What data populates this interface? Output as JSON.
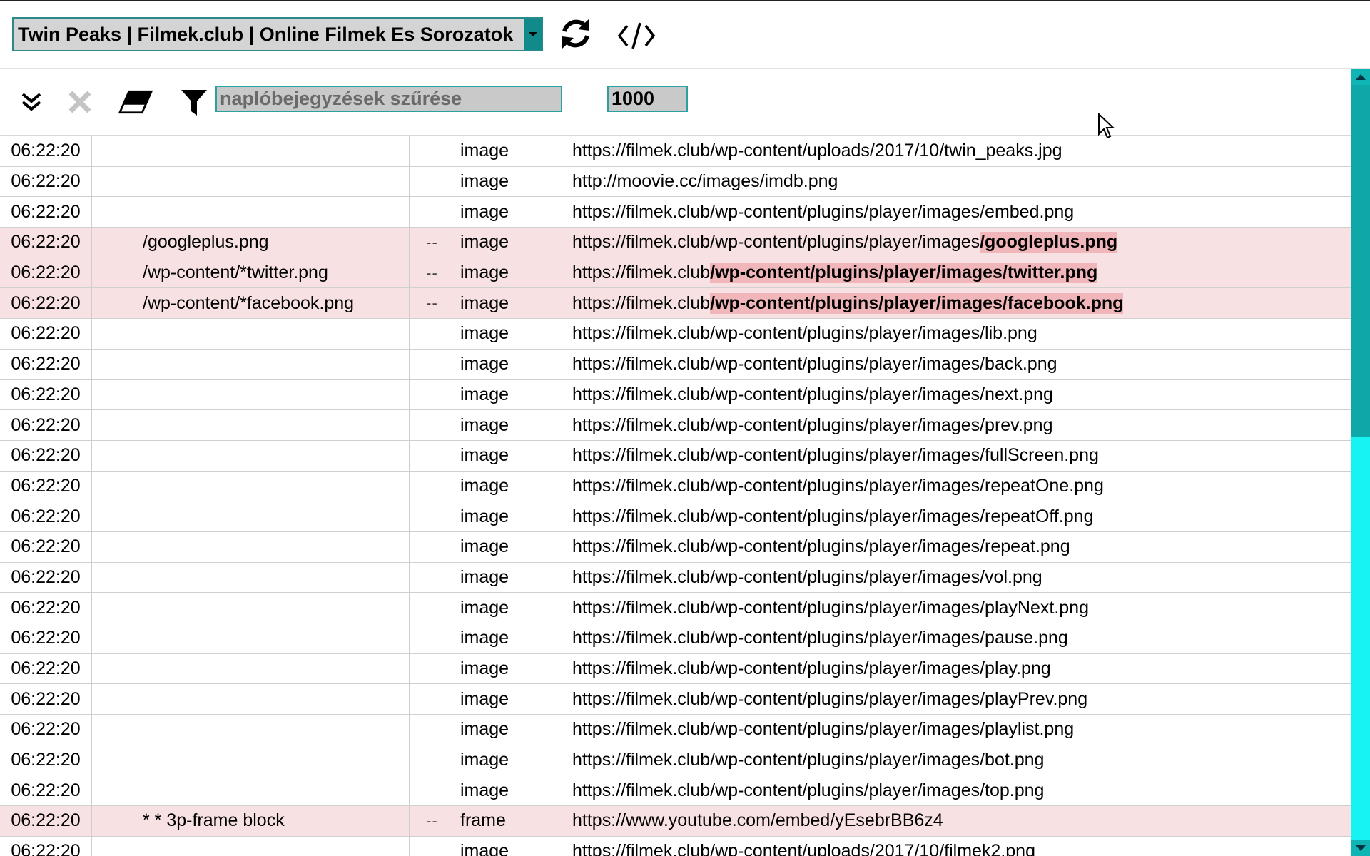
{
  "header": {
    "tab_selector": "Twin Peaks | Filmek.club | Online Filmek Es Sorozatok",
    "reload_icon": "refresh-icon",
    "code_icon": "code-icon"
  },
  "toolbar": {
    "expand_icon": "double-chevron-down-icon",
    "clear_icon": "close-icon",
    "eraser_icon": "eraser-icon",
    "filter_icon": "funnel-icon",
    "filter_placeholder": "naplóbejegyzések szűrése",
    "max_entries": "1000"
  },
  "colors": {
    "accent": "#108a8a",
    "blocked_row": "#f8e1e3",
    "highlight": "#f0b6b9",
    "scrollbar": "#17f2f2"
  },
  "log": {
    "rows": [
      {
        "time": "06:22:20",
        "filter": "",
        "flag": "",
        "type": "image",
        "url_pre": "https://filmek.club/wp-content/uploads/2017/10/twin_peaks.jpg",
        "url_hl": "",
        "blocked": false
      },
      {
        "time": "06:22:20",
        "filter": "",
        "flag": "",
        "type": "image",
        "url_pre": "http://moovie.cc/images/imdb.png",
        "url_hl": "",
        "blocked": false
      },
      {
        "time": "06:22:20",
        "filter": "",
        "flag": "",
        "type": "image",
        "url_pre": "https://filmek.club/wp-content/plugins/player/images/embed.png",
        "url_hl": "",
        "blocked": false
      },
      {
        "time": "06:22:20",
        "filter": "/googleplus.png",
        "flag": "--",
        "type": "image",
        "url_pre": "https://filmek.club/wp-content/plugins/player/images",
        "url_hl": "/googleplus.png",
        "blocked": true
      },
      {
        "time": "06:22:20",
        "filter": "/wp-content/*twitter.png",
        "flag": "--",
        "type": "image",
        "url_pre": "https://filmek.club",
        "url_hl": "/wp-content/plugins/player/images/twitter.png",
        "blocked": true
      },
      {
        "time": "06:22:20",
        "filter": "/wp-content/*facebook.png",
        "flag": "--",
        "type": "image",
        "url_pre": "https://filmek.club",
        "url_hl": "/wp-content/plugins/player/images/facebook.png",
        "blocked": true
      },
      {
        "time": "06:22:20",
        "filter": "",
        "flag": "",
        "type": "image",
        "url_pre": "https://filmek.club/wp-content/plugins/player/images/lib.png",
        "url_hl": "",
        "blocked": false
      },
      {
        "time": "06:22:20",
        "filter": "",
        "flag": "",
        "type": "image",
        "url_pre": "https://filmek.club/wp-content/plugins/player/images/back.png",
        "url_hl": "",
        "blocked": false
      },
      {
        "time": "06:22:20",
        "filter": "",
        "flag": "",
        "type": "image",
        "url_pre": "https://filmek.club/wp-content/plugins/player/images/next.png",
        "url_hl": "",
        "blocked": false
      },
      {
        "time": "06:22:20",
        "filter": "",
        "flag": "",
        "type": "image",
        "url_pre": "https://filmek.club/wp-content/plugins/player/images/prev.png",
        "url_hl": "",
        "blocked": false
      },
      {
        "time": "06:22:20",
        "filter": "",
        "flag": "",
        "type": "image",
        "url_pre": "https://filmek.club/wp-content/plugins/player/images/fullScreen.png",
        "url_hl": "",
        "blocked": false
      },
      {
        "time": "06:22:20",
        "filter": "",
        "flag": "",
        "type": "image",
        "url_pre": "https://filmek.club/wp-content/plugins/player/images/repeatOne.png",
        "url_hl": "",
        "blocked": false
      },
      {
        "time": "06:22:20",
        "filter": "",
        "flag": "",
        "type": "image",
        "url_pre": "https://filmek.club/wp-content/plugins/player/images/repeatOff.png",
        "url_hl": "",
        "blocked": false
      },
      {
        "time": "06:22:20",
        "filter": "",
        "flag": "",
        "type": "image",
        "url_pre": "https://filmek.club/wp-content/plugins/player/images/repeat.png",
        "url_hl": "",
        "blocked": false
      },
      {
        "time": "06:22:20",
        "filter": "",
        "flag": "",
        "type": "image",
        "url_pre": "https://filmek.club/wp-content/plugins/player/images/vol.png",
        "url_hl": "",
        "blocked": false
      },
      {
        "time": "06:22:20",
        "filter": "",
        "flag": "",
        "type": "image",
        "url_pre": "https://filmek.club/wp-content/plugins/player/images/playNext.png",
        "url_hl": "",
        "blocked": false
      },
      {
        "time": "06:22:20",
        "filter": "",
        "flag": "",
        "type": "image",
        "url_pre": "https://filmek.club/wp-content/plugins/player/images/pause.png",
        "url_hl": "",
        "blocked": false
      },
      {
        "time": "06:22:20",
        "filter": "",
        "flag": "",
        "type": "image",
        "url_pre": "https://filmek.club/wp-content/plugins/player/images/play.png",
        "url_hl": "",
        "blocked": false
      },
      {
        "time": "06:22:20",
        "filter": "",
        "flag": "",
        "type": "image",
        "url_pre": "https://filmek.club/wp-content/plugins/player/images/playPrev.png",
        "url_hl": "",
        "blocked": false
      },
      {
        "time": "06:22:20",
        "filter": "",
        "flag": "",
        "type": "image",
        "url_pre": "https://filmek.club/wp-content/plugins/player/images/playlist.png",
        "url_hl": "",
        "blocked": false
      },
      {
        "time": "06:22:20",
        "filter": "",
        "flag": "",
        "type": "image",
        "url_pre": "https://filmek.club/wp-content/plugins/player/images/bot.png",
        "url_hl": "",
        "blocked": false
      },
      {
        "time": "06:22:20",
        "filter": "",
        "flag": "",
        "type": "image",
        "url_pre": "https://filmek.club/wp-content/plugins/player/images/top.png",
        "url_hl": "",
        "blocked": false
      },
      {
        "time": "06:22:20",
        "filter": "* * 3p-frame block",
        "flag": "--",
        "type": "frame",
        "url_pre": "https://www.youtube.com/embed/yEsebrBB6z4",
        "url_hl": "",
        "blocked": true
      },
      {
        "time": "06:22:20",
        "filter": "",
        "flag": "",
        "type": "image",
        "url_pre": "https://filmek.club/wp-content/uploads/2017/10/filmek2.png",
        "url_hl": "",
        "blocked": false
      }
    ]
  }
}
